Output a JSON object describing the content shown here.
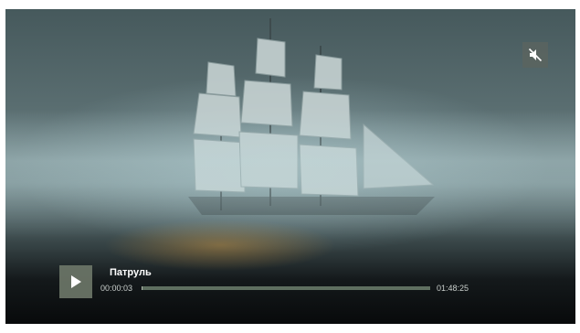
{
  "player": {
    "title": "Патруль",
    "current_time": "00:00:03",
    "total_time": "01:48:25",
    "progress_fraction": 0.0005,
    "muted": true,
    "play_icon": "play-icon",
    "mute_icon": "volume-muted-icon"
  },
  "colors": {
    "control_bg": "#6e7869",
    "progress_track": "#5f6f60",
    "text": "#ffffff"
  }
}
